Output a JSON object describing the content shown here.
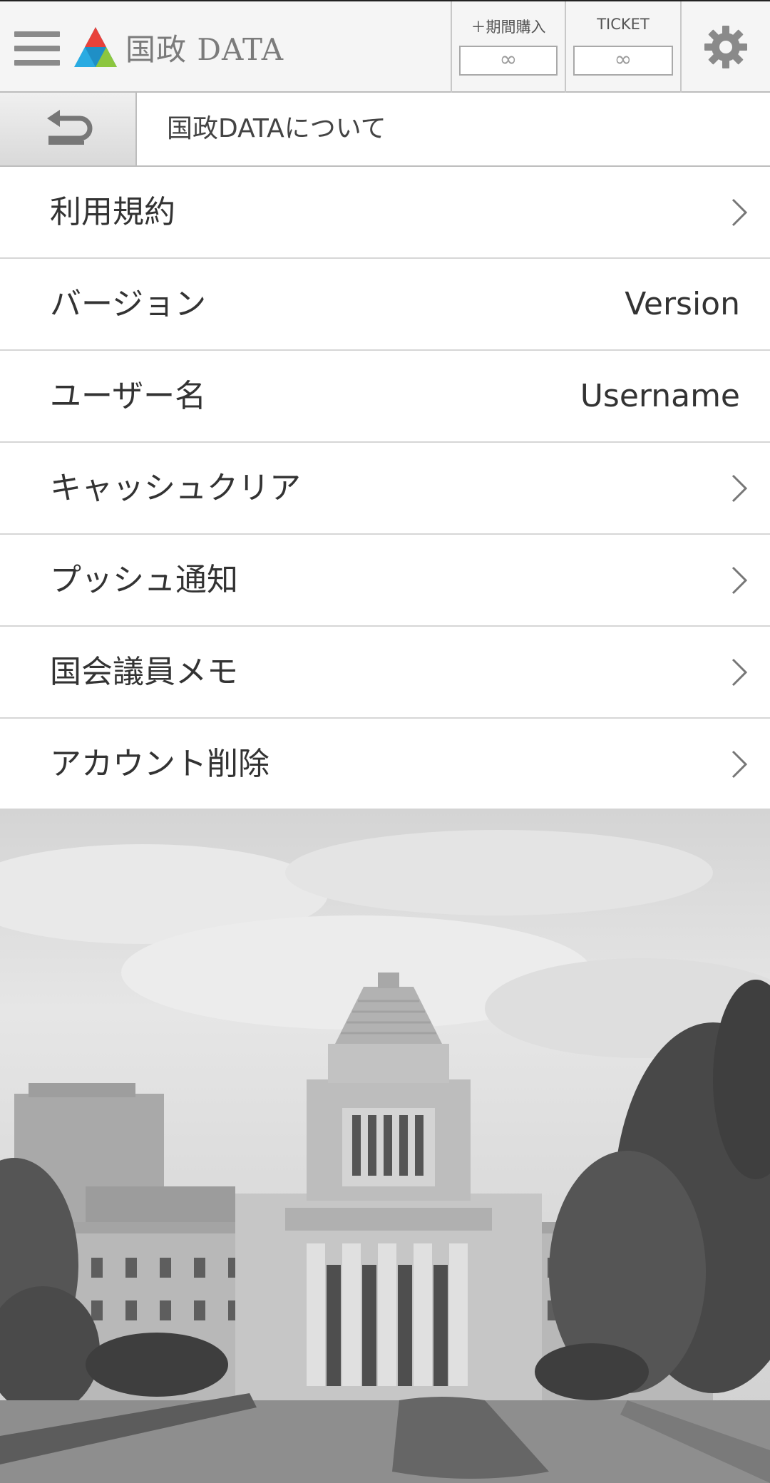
{
  "header": {
    "menu_icon": "hamburger-menu-icon",
    "logo_text": "国政 DATA",
    "period_label": "＋期間購入",
    "period_value": "∞",
    "ticket_label": "TICKET",
    "ticket_value": "∞",
    "settings_icon": "gear-icon"
  },
  "subheader": {
    "back_icon": "return-arrow-icon",
    "title": "国政DATAについて"
  },
  "menu": {
    "items": [
      {
        "label": "利用規約",
        "chevron": true
      },
      {
        "label": "バージョン",
        "value": "Version"
      },
      {
        "label": "ユーザー名",
        "value": "Username"
      },
      {
        "label": "キャッシュクリア",
        "chevron": true
      },
      {
        "label": "プッシュ通知",
        "chevron": true
      },
      {
        "label": "国会議員メモ",
        "chevron": true
      },
      {
        "label": "アカウント削除",
        "chevron": true
      }
    ]
  },
  "colors": {
    "logo_red": "#e8413a",
    "logo_green": "#8cc63f",
    "logo_blue": "#29abe2",
    "chevron": "#777777",
    "icon_gray": "#8a8a8a"
  }
}
